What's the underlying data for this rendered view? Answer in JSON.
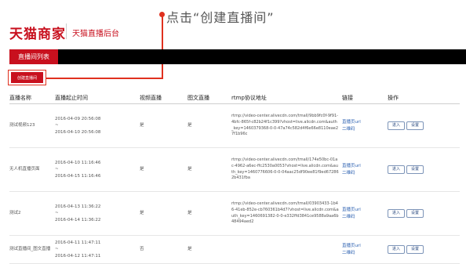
{
  "callout": {
    "text": "点击“创建直播间”"
  },
  "header": {
    "logo": "天猫商家",
    "subtitle": "天猫直播后台"
  },
  "nav": {
    "active_tab": "直播间列表"
  },
  "toolbar": {
    "create_label": "创建直播间"
  },
  "table": {
    "headers": [
      "直播名称",
      "直播起止时间",
      "视频直播",
      "图文直播",
      "rtmp协议地址",
      "链接",
      "操作"
    ],
    "rows": [
      {
        "name": "测试视频123",
        "start": "2016-04-09 20:56:08",
        "sep": "~",
        "end": "2016-04-10 20:56:08",
        "video": "是",
        "graphic": "是",
        "rtmp": "rtmp://video-center.alivecdn.com/tmall/9bb9fc0f-9f91-4bfc-865f-c82b24f1c399?vhost=live.alicdn.com&auth_key=1460379368-0-0-47a74c582d4f6e66e8110eae27f1b96c",
        "link1": "直播页url",
        "link2": "二维码",
        "op1": "进入",
        "op2": "设置"
      },
      {
        "name": "无人机直播页面",
        "start": "2016-04-10 11:16:46",
        "sep": "~",
        "end": "2016-04-15 11:16:46",
        "video": "是",
        "graphic": "是",
        "rtmp": "rtmp://video-center.alivecdn.com/tmall/174e50bc-01ac-4962-a6ec-ffc2530a0053?vhost=live.alicdn.com&auth_key=1460776606-0-0-04aac25df90ee81f9ed672862b431fba",
        "link1": "直播页url",
        "link2": "二维码",
        "op1": "进入",
        "op2": "设置"
      },
      {
        "name": "测试2",
        "start": "2016-04-13 11:36:22",
        "sep": "~",
        "end": "2016-04-14 11:36:22",
        "video": "是",
        "graphic": "是",
        "rtmp": "rtmp://video-center.alivecdn.com/tmall/03903433-1b46-41eb-852e-cb760361b4d7?vhost=live.alicdn.com&auth_key=1460691382-0-0-e332ffd3841ce9588a9aa6b48494aed2",
        "link1": "直播页url",
        "link2": "二维码",
        "op1": "进入",
        "op2": "设置"
      },
      {
        "name": "测试直播间_图文直播",
        "start": "2016-04-11 11:47:11",
        "sep": "~",
        "end": "2016-04-12 11:47:11",
        "video": "否",
        "graphic": "是",
        "rtmp": "",
        "link1": "直播页url",
        "link2": "二维码",
        "op1": "进入",
        "op2": "设置"
      }
    ]
  },
  "colors": {
    "brand": "#c8101e",
    "annotation": "#e0311f",
    "link": "#2a5fb0"
  }
}
